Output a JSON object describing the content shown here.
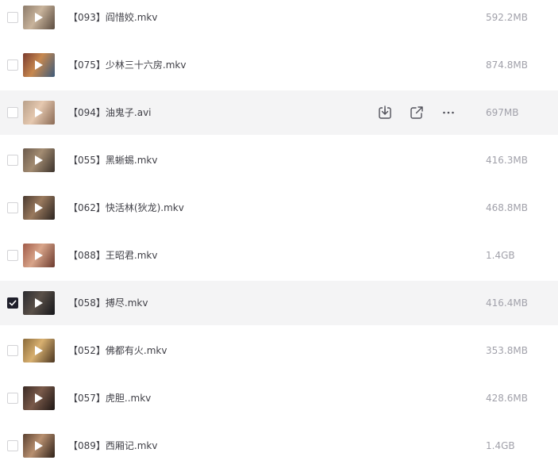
{
  "files": [
    {
      "name": "【093】阎惜姣.mkv",
      "size": "592.2MB",
      "checked": false,
      "hover": false,
      "thumb_colors": [
        "#8c7b6a",
        "#c9b49c",
        "#5a4b3f"
      ]
    },
    {
      "name": "【075】少林三十六房.mkv",
      "size": "874.8MB",
      "checked": false,
      "hover": false,
      "thumb_colors": [
        "#7a3b2e",
        "#c7884f",
        "#3d5a7a"
      ]
    },
    {
      "name": "【094】油鬼子.avi",
      "size": "697MB",
      "checked": false,
      "hover": true,
      "thumb_colors": [
        "#b8a08a",
        "#e6c9b0",
        "#8a6a55"
      ]
    },
    {
      "name": "【055】黑蜥蜴.mkv",
      "size": "416.3MB",
      "checked": false,
      "hover": false,
      "thumb_colors": [
        "#6b5a4c",
        "#a38c72",
        "#3b322b"
      ]
    },
    {
      "name": "【062】快活林(狄龙).mkv",
      "size": "468.8MB",
      "checked": false,
      "hover": false,
      "thumb_colors": [
        "#4a3a30",
        "#9a7a5e",
        "#2b2420"
      ]
    },
    {
      "name": "【088】王昭君.mkv",
      "size": "1.4GB",
      "checked": false,
      "hover": false,
      "thumb_colors": [
        "#a05a48",
        "#d9a58a",
        "#6b3a2e"
      ]
    },
    {
      "name": "【058】搏尽.mkv",
      "size": "416.4MB",
      "checked": true,
      "hover": true,
      "thumb_colors": [
        "#2a2a2e",
        "#5a5048",
        "#15161a"
      ]
    },
    {
      "name": "【052】佛都有火.mkv",
      "size": "353.8MB",
      "checked": false,
      "hover": false,
      "thumb_colors": [
        "#8a6a3a",
        "#d8b070",
        "#4a3520"
      ]
    },
    {
      "name": "【057】虎胆..mkv",
      "size": "428.6MB",
      "checked": false,
      "hover": false,
      "thumb_colors": [
        "#3a2a24",
        "#7a5a4a",
        "#1e1614"
      ]
    },
    {
      "name": "【089】西厢记.mkv",
      "size": "1.4GB",
      "checked": false,
      "hover": false,
      "thumb_colors": [
        "#5a4030",
        "#b89070",
        "#2e2018"
      ]
    }
  ],
  "actions": [
    {
      "icon": "download-icon"
    },
    {
      "icon": "share-icon"
    },
    {
      "icon": "more-icon"
    }
  ]
}
